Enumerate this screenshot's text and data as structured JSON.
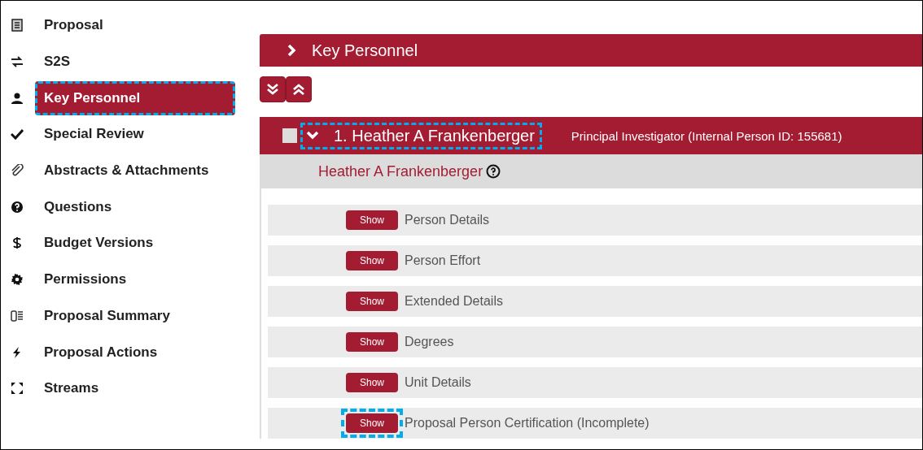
{
  "sidebar": {
    "items": [
      {
        "label": "Proposal",
        "selected": false,
        "highlighted": false
      },
      {
        "label": "S2S",
        "selected": false,
        "highlighted": false
      },
      {
        "label": "Key Personnel",
        "selected": true,
        "highlighted": true
      },
      {
        "label": "Special Review",
        "selected": false,
        "highlighted": false
      },
      {
        "label": "Abstracts & Attachments",
        "selected": false,
        "highlighted": false
      },
      {
        "label": "Questions",
        "selected": false,
        "highlighted": false
      },
      {
        "label": "Budget Versions",
        "selected": false,
        "highlighted": false
      },
      {
        "label": "Permissions",
        "selected": false,
        "highlighted": false
      },
      {
        "label": "Proposal Summary",
        "selected": false,
        "highlighted": false
      },
      {
        "label": "Proposal Actions",
        "selected": false,
        "highlighted": false
      },
      {
        "label": "Streams",
        "selected": false,
        "highlighted": false
      }
    ]
  },
  "section": {
    "title": "Key Personnel",
    "expanded": true
  },
  "person": {
    "checked": false,
    "expanded": true,
    "title": "1. Heather A Frankenberger",
    "title_highlighted": true,
    "role": "Principal Investigator (Internal Person ID: 155681)",
    "name": "Heather A Frankenberger",
    "panels": [
      {
        "button": "Show",
        "label": "Person Details",
        "highlighted": false
      },
      {
        "button": "Show",
        "label": "Person Effort",
        "highlighted": false
      },
      {
        "button": "Show",
        "label": "Extended Details",
        "highlighted": false
      },
      {
        "button": "Show",
        "label": "Degrees",
        "highlighted": false
      },
      {
        "button": "Show",
        "label": "Unit Details",
        "highlighted": false
      },
      {
        "button": "Show",
        "label": "Proposal Person Certification (Incomplete)",
        "highlighted": true
      }
    ]
  }
}
